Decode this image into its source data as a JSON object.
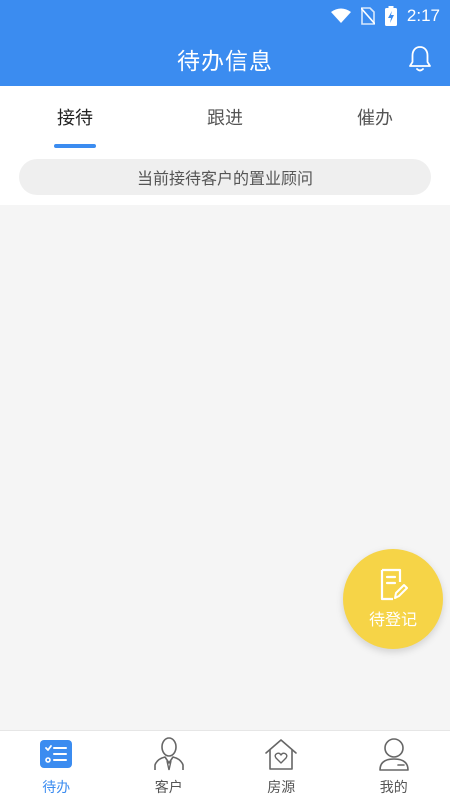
{
  "status_bar": {
    "time": "2:17"
  },
  "app_bar": {
    "title": "待办信息"
  },
  "tabs": [
    {
      "label": "接待",
      "active": true
    },
    {
      "label": "跟进",
      "active": false
    },
    {
      "label": "催办",
      "active": false
    }
  ],
  "info": {
    "text": "当前接待客户的置业顾问"
  },
  "fab": {
    "label": "待登记"
  },
  "bottom_nav": [
    {
      "label": "待办",
      "icon": "todo-list-icon",
      "active": true
    },
    {
      "label": "客户",
      "icon": "customer-icon",
      "active": false
    },
    {
      "label": "房源",
      "icon": "house-heart-icon",
      "active": false
    },
    {
      "label": "我的",
      "icon": "profile-icon",
      "active": false
    }
  ],
  "colors": {
    "primary": "#3b8cf0",
    "fab": "#f6d447",
    "background": "#f5f5f5"
  }
}
